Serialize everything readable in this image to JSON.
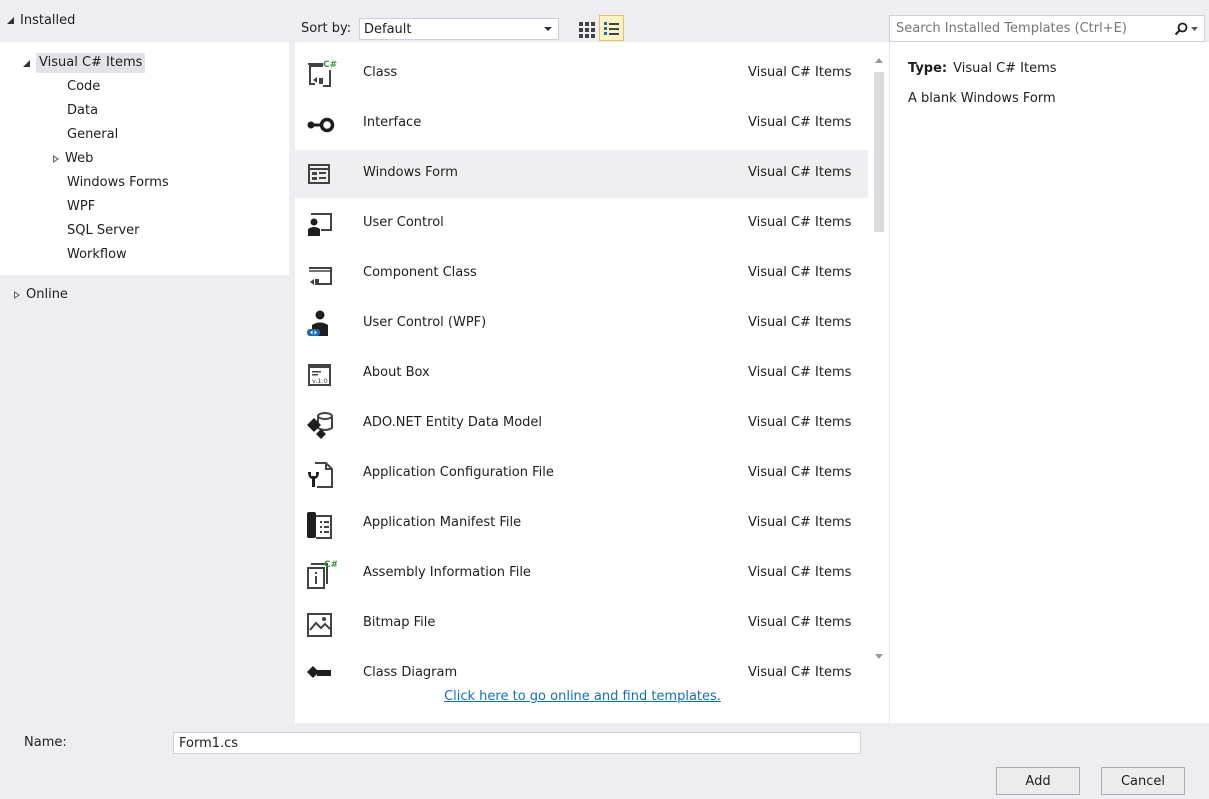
{
  "tree": {
    "installed_label": "Installed",
    "root_label": "Visual C# Items",
    "children": [
      "Code",
      "Data",
      "General",
      "Web",
      "Windows Forms",
      "WPF",
      "SQL Server",
      "Workflow"
    ],
    "online_label": "Online"
  },
  "toolbar": {
    "sort_label": "Sort by:",
    "sort_value": "Default",
    "view_small_icons": "small-icons-view-icon",
    "view_details": "details-view-icon"
  },
  "search": {
    "placeholder": "Search Installed Templates (Ctrl+E)"
  },
  "templates": [
    {
      "name": "Class",
      "category": "Visual C# Items",
      "icon": "csharp-class-icon"
    },
    {
      "name": "Interface",
      "category": "Visual C# Items",
      "icon": "interface-icon"
    },
    {
      "name": "Windows Form",
      "category": "Visual C# Items",
      "icon": "windows-form-icon"
    },
    {
      "name": "User Control",
      "category": "Visual C# Items",
      "icon": "user-control-icon"
    },
    {
      "name": "Component Class",
      "category": "Visual C# Items",
      "icon": "component-class-icon"
    },
    {
      "name": "User Control (WPF)",
      "category": "Visual C# Items",
      "icon": "wpf-user-control-icon"
    },
    {
      "name": "About Box",
      "category": "Visual C# Items",
      "icon": "about-box-icon"
    },
    {
      "name": "ADO.NET Entity Data Model",
      "category": "Visual C# Items",
      "icon": "entity-data-model-icon"
    },
    {
      "name": "Application Configuration File",
      "category": "Visual C# Items",
      "icon": "config-file-icon"
    },
    {
      "name": "Application Manifest File",
      "category": "Visual C# Items",
      "icon": "manifest-file-icon"
    },
    {
      "name": "Assembly Information File",
      "category": "Visual C# Items",
      "icon": "assembly-info-icon"
    },
    {
      "name": "Bitmap File",
      "category": "Visual C# Items",
      "icon": "bitmap-file-icon"
    },
    {
      "name": "Class Diagram",
      "category": "Visual C# Items",
      "icon": "class-diagram-icon"
    }
  ],
  "online_link": "Click here to go online and find templates.",
  "details": {
    "type_label": "Type:",
    "type_value": "Visual C# Items",
    "description": "A blank Windows Form"
  },
  "name_field": {
    "label": "Name:",
    "value": "Form1.cs"
  },
  "buttons": {
    "add": "Add",
    "cancel": "Cancel"
  },
  "colors": {
    "link": "#0e70c0",
    "selection": "#efeff2",
    "accent_green": "#3a9a3a",
    "accent_blue": "#1c6bb6"
  }
}
